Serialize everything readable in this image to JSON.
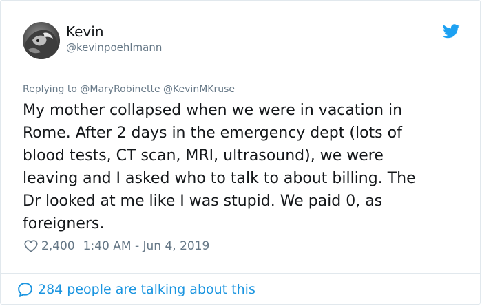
{
  "user": {
    "display_name": "Kevin",
    "handle": "@kevinpoehlmann"
  },
  "reply": {
    "text": "Replying to @MaryRobinette @KevinMKruse"
  },
  "tweet": {
    "text": "My mother collapsed when we were in vacation in\nRome. After 2 days in the emergency dept (lots of\nblood tests, CT scan, MRI, ultrasound), we were\nleaving and I asked who to talk to about billing.  The\nDr looked at me like I was stupid.  We paid 0, as\nforeigners.",
    "likes": "2,400",
    "timestamp": "1:40 AM - Jun 4, 2019"
  },
  "footer": {
    "talking_label": "284 people are talking about this"
  },
  "icons": {
    "bird": "twitter-bird-icon",
    "heart": "heart-icon",
    "bubble": "speech-bubble-icon"
  },
  "colors": {
    "twitter_blue": "#1da1f2",
    "link_blue": "#1b95e0",
    "secondary_text": "#657786",
    "primary_text": "#14171a",
    "border": "#e1e8ed"
  }
}
